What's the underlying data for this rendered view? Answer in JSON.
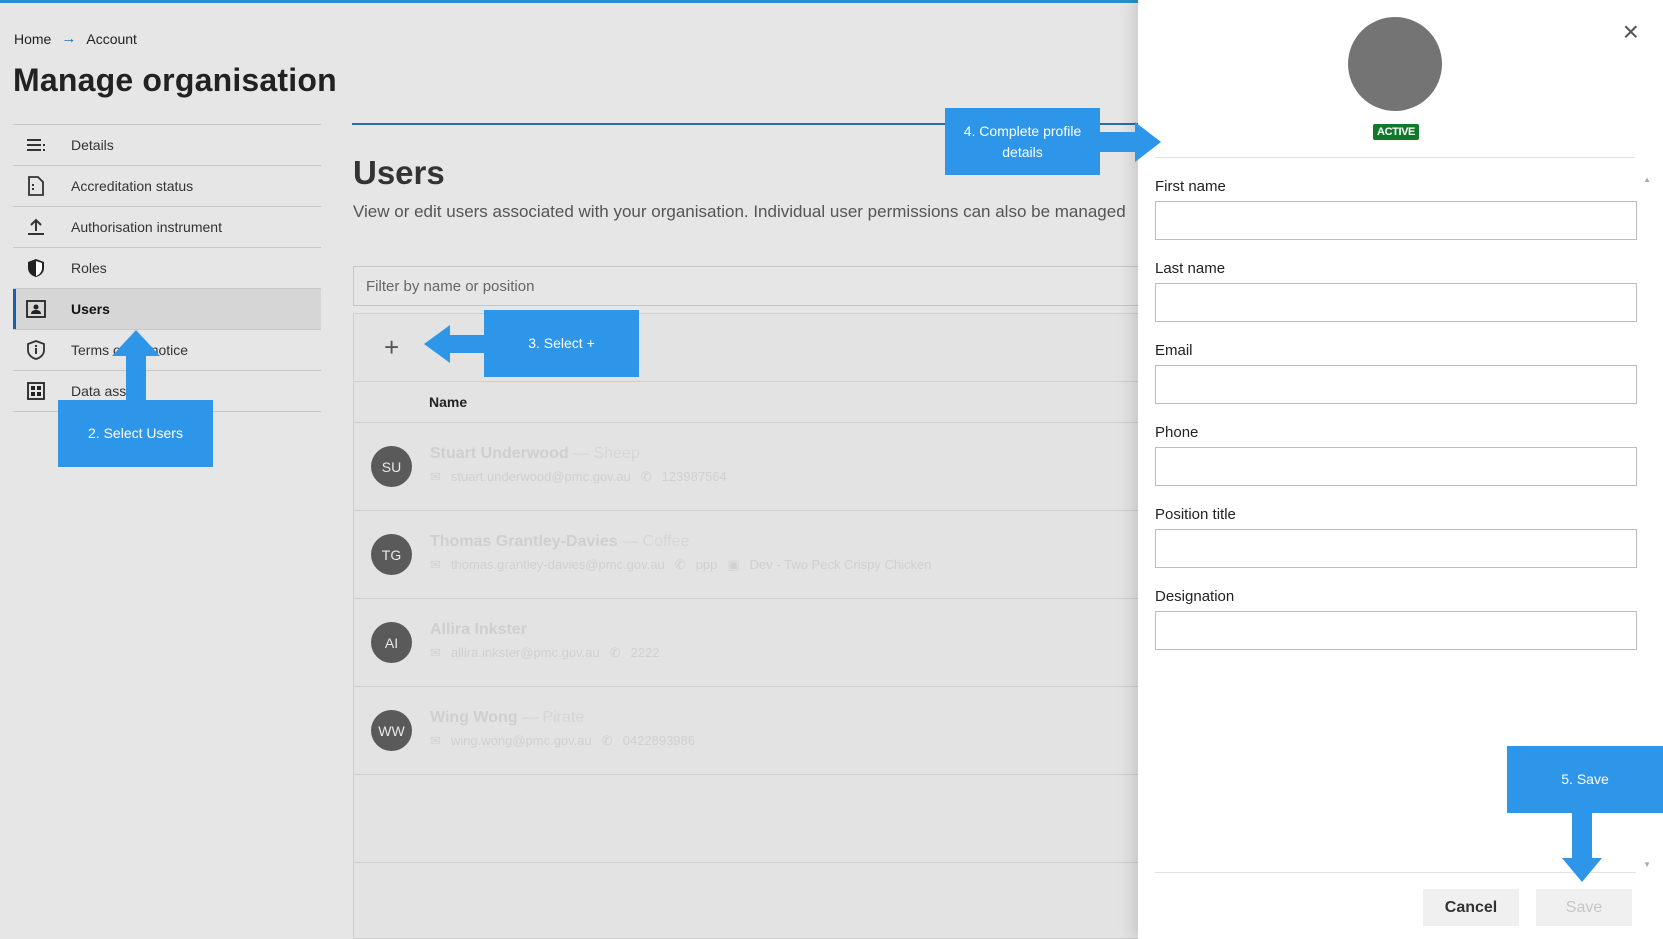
{
  "breadcrumb": {
    "home": "Home",
    "arrow": "→",
    "current": "Account"
  },
  "page_title": "Manage organisation",
  "sidebar": {
    "items": [
      {
        "label": "Details",
        "icon": "list-icon"
      },
      {
        "label": "Accreditation status",
        "icon": "document-icon"
      },
      {
        "label": "Authorisation instrument",
        "icon": "upload-icon"
      },
      {
        "label": "Roles",
        "icon": "shield-icon"
      },
      {
        "label": "Users",
        "icon": "contact-card-icon",
        "active": true
      },
      {
        "label": "Terms of use notice",
        "icon": "info-shield-icon"
      },
      {
        "label": "Data assets",
        "icon": "grid-icon"
      }
    ],
    "visible_labels": [
      "Details",
      "Accreditation status",
      "Authorisation instrument",
      "Roles",
      "Users",
      "Terms of",
      "notice",
      "Data ass"
    ]
  },
  "section": {
    "title": "Users",
    "description": "View or edit users associated with your organisation. Individual user permissions can also be managed"
  },
  "filter": {
    "placeholder": "Filter by name or position"
  },
  "table": {
    "add_label": "+",
    "column_name": "Name",
    "rows": [
      {
        "initials": "SU",
        "name": "Stuart Underwood",
        "position": "— Sheep",
        "email": "stuart.underwood@pmc.gov.au",
        "phone": "123987564",
        "org": ""
      },
      {
        "initials": "TG",
        "name": "Thomas Grantley-Davies",
        "position": "— Coffee",
        "email": "thomas.grantley-davies@pmc.gov.au",
        "phone": "ppp",
        "org": "Dev - Two Peck Crispy Chicken"
      },
      {
        "initials": "AI",
        "name": "Allira Inkster",
        "position": "",
        "email": "allira.inkster@pmc.gov.au",
        "phone": "2222",
        "org": ""
      },
      {
        "initials": "WW",
        "name": "Wing Wong",
        "position": "— Pirate",
        "email": "wing.wong@pmc.gov.au",
        "phone": "0422893986",
        "org": ""
      }
    ]
  },
  "drawer": {
    "close": "×",
    "status": "ACTIVE",
    "fields": [
      {
        "label": "First name",
        "value": ""
      },
      {
        "label": "Last name",
        "value": ""
      },
      {
        "label": "Email",
        "value": ""
      },
      {
        "label": "Phone",
        "value": ""
      },
      {
        "label": "Position title",
        "value": ""
      },
      {
        "label": "Designation",
        "value": ""
      }
    ],
    "cancel": "Cancel",
    "save": "Save"
  },
  "callouts": {
    "select_users": "2. Select Users",
    "select_plus": "3. Select +",
    "complete_profile": "4. Complete profile details",
    "save": "5. Save"
  },
  "colors": {
    "callout": "#2d96e8",
    "accent": "#1d5fa6",
    "active_badge": "#117a2a"
  }
}
